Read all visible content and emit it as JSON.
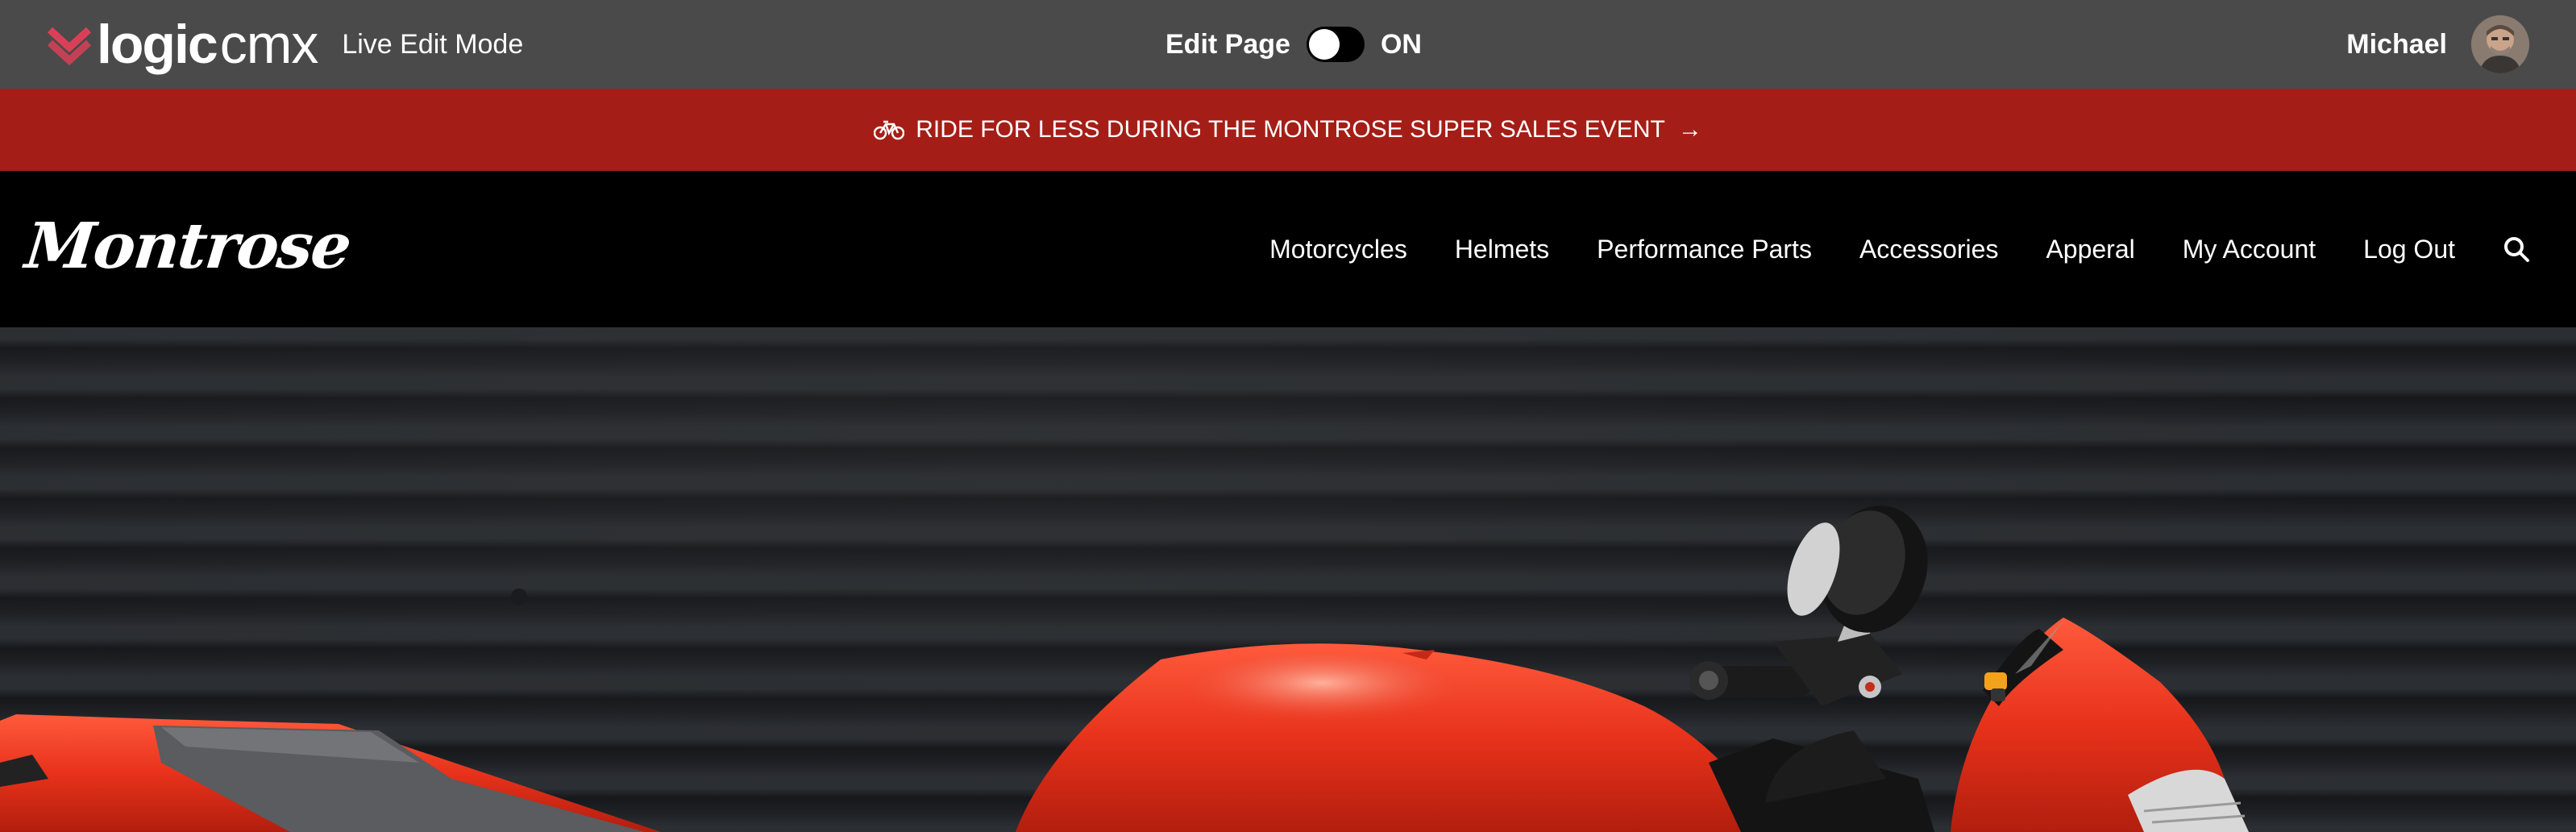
{
  "cms_bar": {
    "logo_bold": "logic",
    "logo_light": "cmx",
    "mode_label": "Live Edit Mode",
    "edit_label": "Edit Page",
    "edit_state": "ON",
    "user_name": "Michael",
    "brand_color": "#d94057"
  },
  "promo": {
    "text": "RIDE FOR LESS DURING THE MONTROSE SUPER SALES EVENT",
    "icon": "bicycle-icon",
    "arrow_icon": "arrow-right-icon",
    "background": "#a41e17"
  },
  "site": {
    "logo": "Montrose",
    "nav": [
      "Motorcycles",
      "Helmets",
      "Performance Parts",
      "Accessories",
      "Apperal",
      "My Account",
      "Log Out"
    ],
    "search_icon": "search-icon"
  },
  "hero": {
    "image": "red-motorcycle",
    "accent": "#e8321b"
  }
}
